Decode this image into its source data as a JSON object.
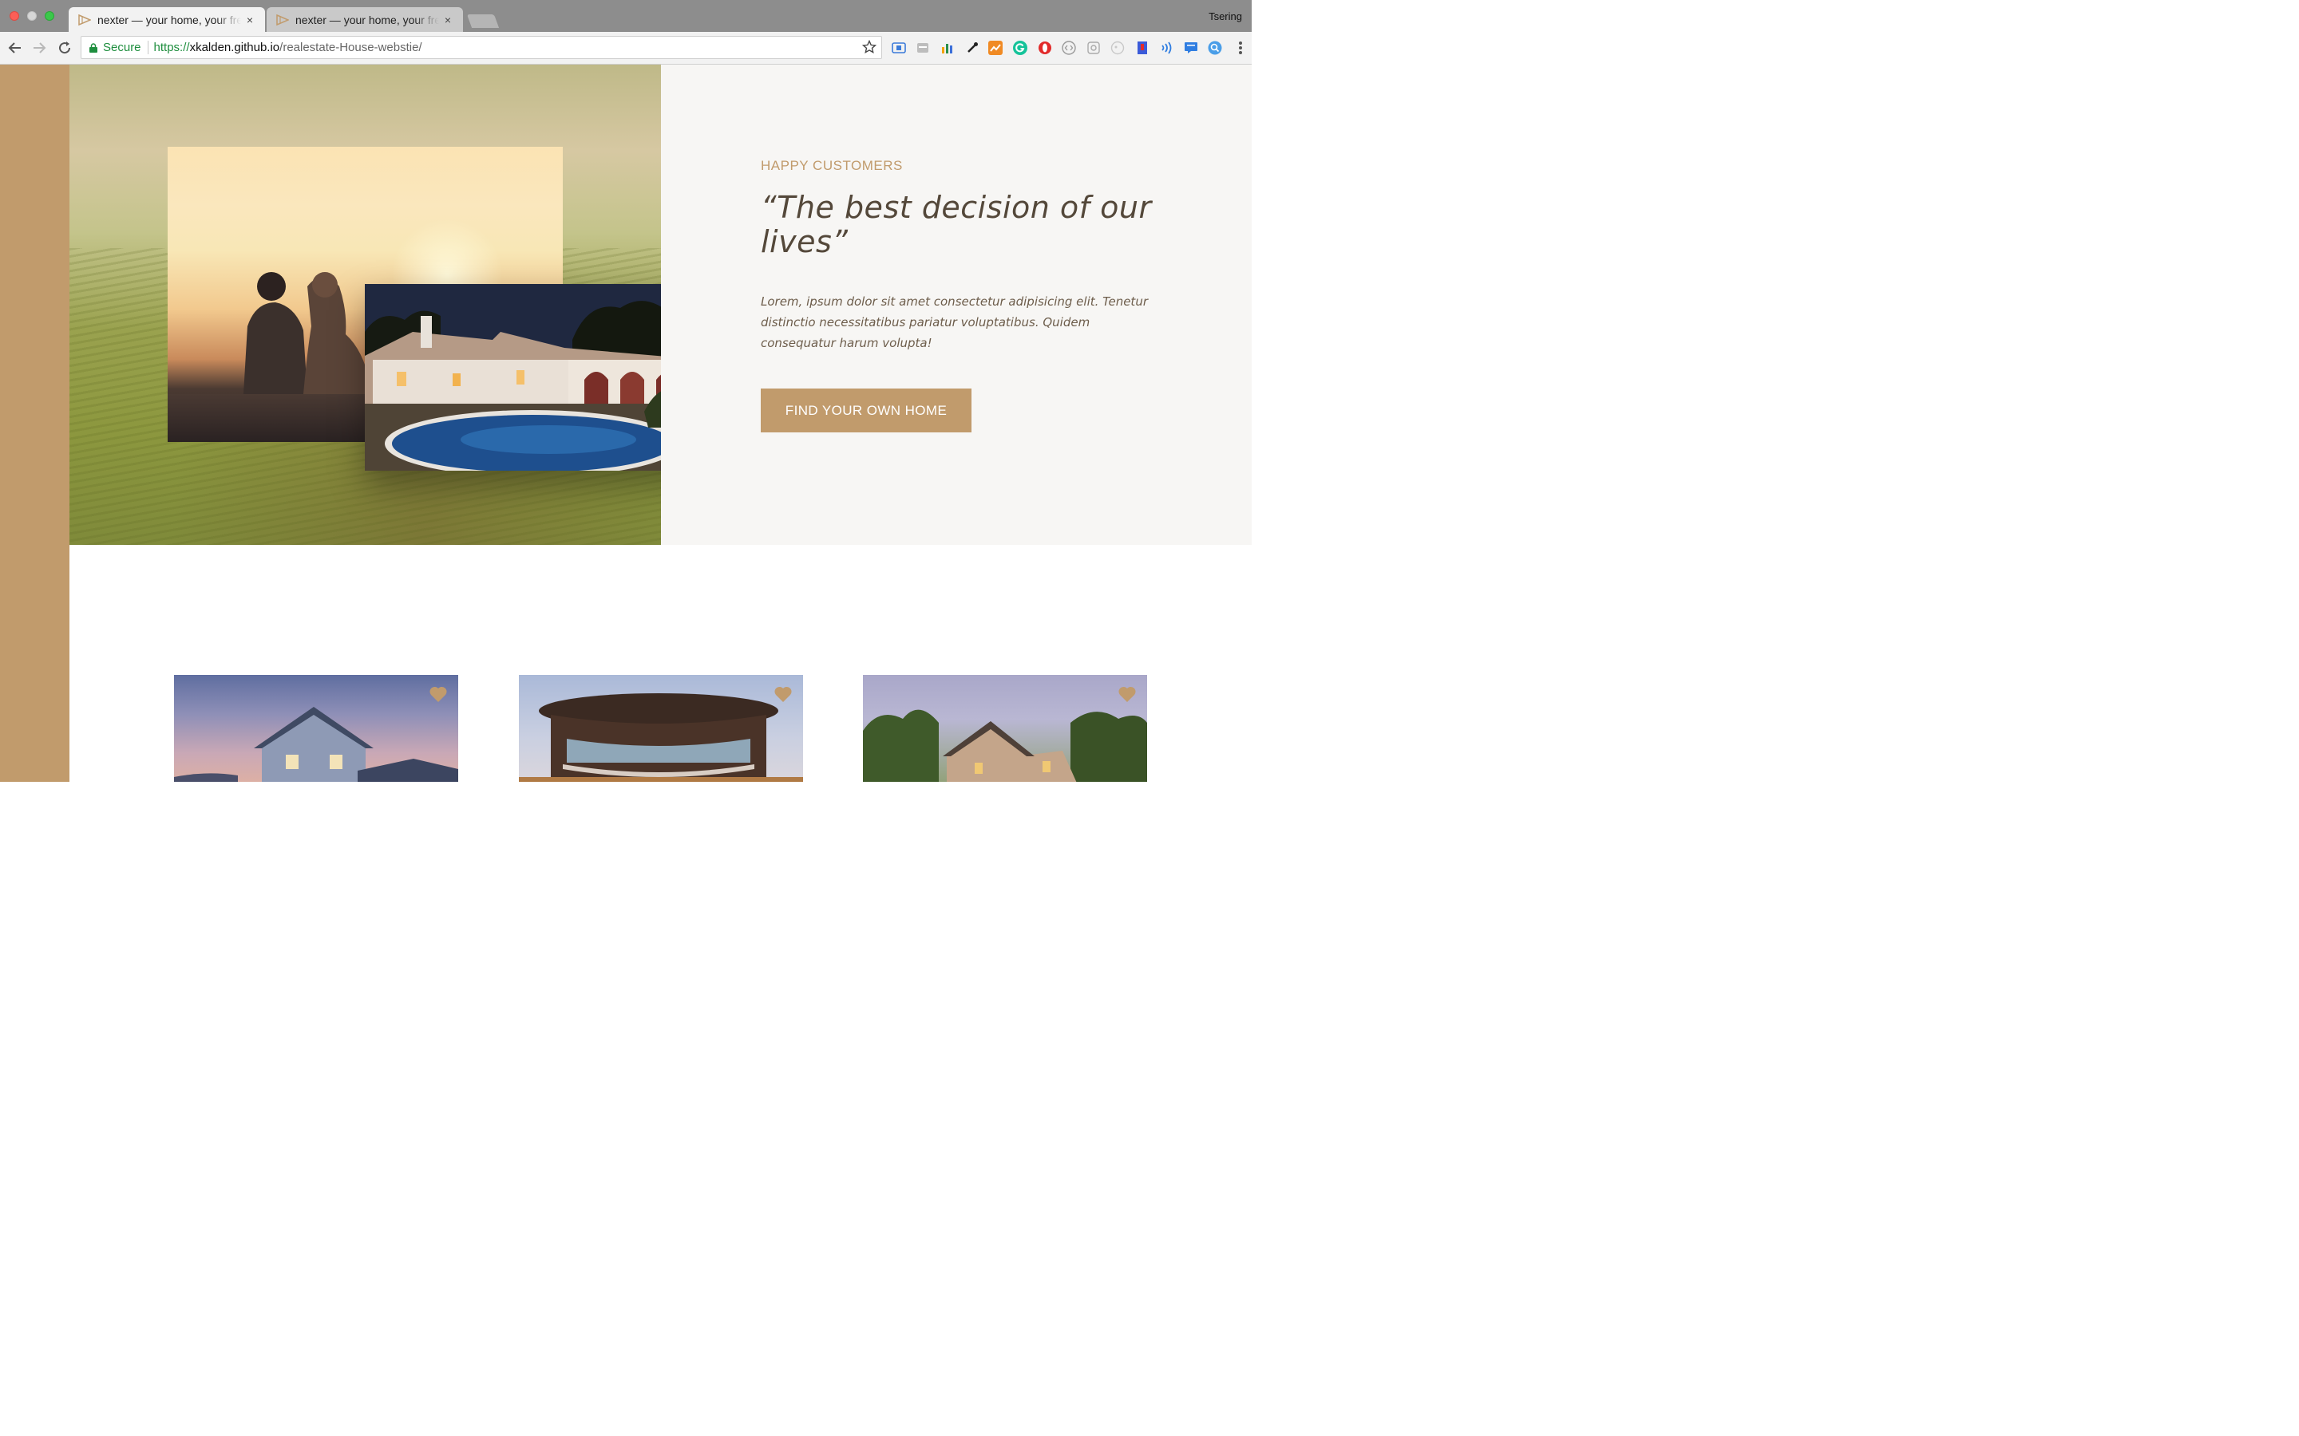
{
  "browser": {
    "tabs": [
      {
        "title": "nexter — your home, your freedom",
        "close": "×"
      },
      {
        "title": "nexter — your home, your freedom",
        "close": "×"
      }
    ],
    "profile_name": "Tsering",
    "address_bar": {
      "secure_label": "Secure",
      "url_scheme": "https://",
      "url_host": "xkalden.github.io",
      "url_path": "/realestate-House-webstie/"
    },
    "extension_icons": [
      "card-icon",
      "window-icon",
      "bar-chart-icon",
      "eyedropper-icon",
      "trend-icon",
      "grammarly-icon",
      "opera-icon",
      "code-icon",
      "puzzle-icon",
      "ghost-icon",
      "bookmark-icon",
      "wave-icon",
      "chat-icon",
      "search-icon"
    ]
  },
  "story": {
    "eyebrow": "Happy Customers",
    "quote": "“The best decision of our lives”",
    "paragraph": "Lorem, ipsum dolor sit amet consectetur adipisicing elit. Tenetur distinctio necessitatibus pariatur voluptatibus. Quidem consequatur harum volupta!",
    "cta_label": "Find your own home"
  },
  "colors": {
    "primary": "#c19b6c",
    "quote_text": "#54483a",
    "story_bg": "#f7f6f4"
  }
}
